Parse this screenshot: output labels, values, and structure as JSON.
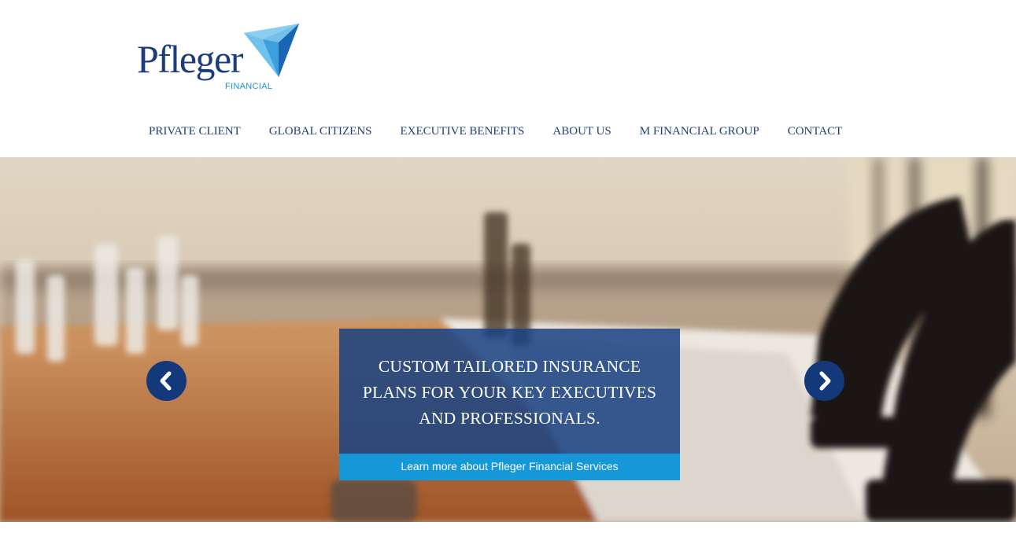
{
  "logo": {
    "name": "Pfleger",
    "subtitle": "FINANCIAL",
    "icon": "triangle-logo-icon",
    "colors": {
      "word": "#1d3d7a",
      "sub": "#1e95d3",
      "mark_light": "#6fc2ec",
      "mark_dark": "#1b66b4"
    }
  },
  "nav": {
    "items": [
      {
        "label": "PRIVATE CLIENT"
      },
      {
        "label": "GLOBAL CITIZENS"
      },
      {
        "label": "EXECUTIVE BENEFITS"
      },
      {
        "label": "ABOUT US"
      },
      {
        "label": "M FINANCIAL GROUP"
      },
      {
        "label": "CONTACT"
      }
    ]
  },
  "hero": {
    "image": "conference-room-photo",
    "caption": {
      "lines": [
        "CUSTOM TAILORED INSURANCE",
        "PLANS FOR YOUR KEY EXECUTIVES",
        "AND PROFESSIONALS."
      ],
      "link_label": "Learn more about Pfleger Financial Services"
    },
    "prev_icon": "chevron-left-icon",
    "next_icon": "chevron-right-icon"
  },
  "colors": {
    "primary": "#14397a",
    "accent": "#1698d8",
    "caption_bg": "#1a4282"
  }
}
